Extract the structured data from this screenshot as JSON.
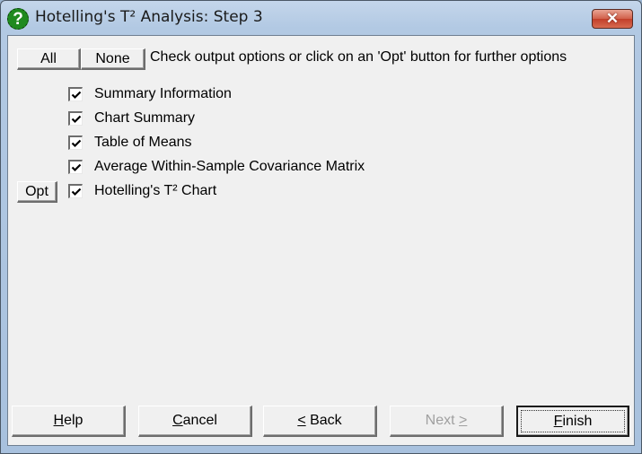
{
  "window": {
    "title": "Hotelling's T² Analysis: Step 3",
    "icon": "help-question-icon",
    "close_label": "✕"
  },
  "toolbar": {
    "all_label": "All",
    "none_label": "None",
    "instruction": "Check output options or click on an 'Opt' button for further options"
  },
  "options": [
    {
      "label": "Summary Information",
      "checked": true,
      "has_opt": false
    },
    {
      "label": "Chart Summary",
      "checked": true,
      "has_opt": false
    },
    {
      "label": "Table of Means",
      "checked": true,
      "has_opt": false
    },
    {
      "label": "Average Within-Sample Covariance Matrix",
      "checked": true,
      "has_opt": false
    },
    {
      "label": "Hotelling's T² Chart",
      "checked": true,
      "has_opt": true
    }
  ],
  "opt_button_label": "Opt",
  "footer": {
    "help": {
      "mnemonic": "H",
      "rest": "elp"
    },
    "cancel": {
      "mnemonic": "C",
      "rest": "ancel"
    },
    "back": {
      "prefix": "",
      "mnemonic": "<",
      "rest": " Back"
    },
    "next": {
      "prefix": "Next ",
      "mnemonic": ">",
      "rest": "",
      "disabled": true
    },
    "finish": {
      "mnemonic": "F",
      "rest": "inish",
      "default": true
    }
  }
}
